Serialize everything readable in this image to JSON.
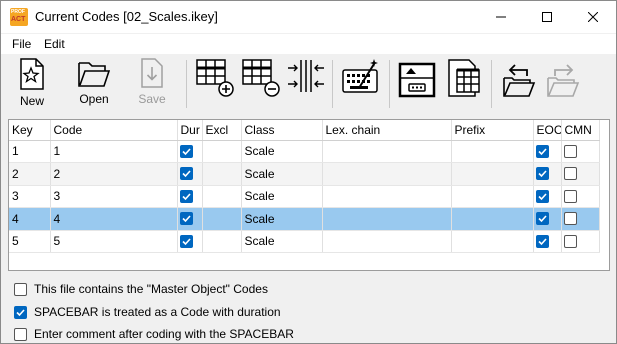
{
  "window": {
    "title": "Current Codes [02_Scales.ikey]",
    "icon_name": "mangold-app-icon",
    "icon_text_top": "PROF",
    "icon_text_bottom": "ACT",
    "controls": [
      "minimize-icon",
      "maximize-icon",
      "close-icon"
    ]
  },
  "menu": {
    "items": [
      {
        "label": "File"
      },
      {
        "label": "Edit"
      }
    ]
  },
  "toolbar": {
    "new_label": "New",
    "open_label": "Open",
    "save_label": "Save",
    "icons": [
      "new-file-icon",
      "open-folder-icon",
      "save-icon",
      "add-column-icon",
      "remove-column-icon",
      "column-width-icon",
      "keyboard-wand-icon",
      "export-archive-icon",
      "spreadsheet-import-icon",
      "undo-folder-icon",
      "redo-folder-icon"
    ]
  },
  "table": {
    "columns": [
      "Key",
      "Code",
      "Dur",
      "Excl",
      "Class",
      "Lex. chain",
      "Prefix",
      "EOC",
      "CMN"
    ],
    "rows": [
      {
        "key": "1",
        "code": "1",
        "dur": true,
        "excl": "",
        "class": "Scale",
        "lex": "",
        "prefix": "",
        "eoc": true,
        "cmn": false,
        "selected": false
      },
      {
        "key": "2",
        "code": "2",
        "dur": true,
        "excl": "",
        "class": "Scale",
        "lex": "",
        "prefix": "",
        "eoc": true,
        "cmn": false,
        "selected": false
      },
      {
        "key": "3",
        "code": "3",
        "dur": true,
        "excl": "",
        "class": "Scale",
        "lex": "",
        "prefix": "",
        "eoc": true,
        "cmn": false,
        "selected": false
      },
      {
        "key": "4",
        "code": "4",
        "dur": true,
        "excl": "",
        "class": "Scale",
        "lex": "",
        "prefix": "",
        "eoc": true,
        "cmn": false,
        "selected": true
      },
      {
        "key": "5",
        "code": "5",
        "dur": true,
        "excl": "",
        "class": "Scale",
        "lex": "",
        "prefix": "",
        "eoc": true,
        "cmn": false,
        "selected": false
      }
    ]
  },
  "options": [
    {
      "label": "This file contains the \"Master Object\" Codes",
      "checked": false
    },
    {
      "label": "SPACEBAR is treated as a Code with duration",
      "checked": true
    },
    {
      "label": "Enter comment after coding with the SPACEBAR",
      "checked": false
    }
  ],
  "colors": {
    "accent": "#0067c0",
    "selection": "#99c9ef",
    "app_icon": "#f5a623"
  }
}
